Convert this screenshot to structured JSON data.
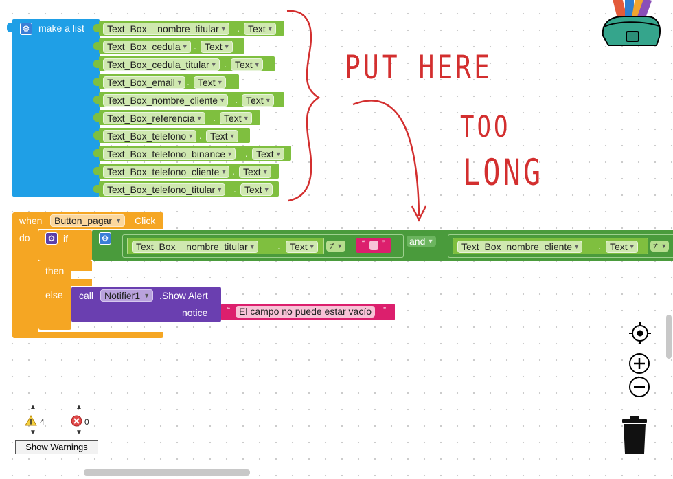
{
  "make_list": {
    "label": "make a list",
    "items": [
      {
        "component": "Text_Box__nombre_titular",
        "property": "Text"
      },
      {
        "component": "Text_Box_cedula",
        "property": "Text"
      },
      {
        "component": "Text_Box_cedula_titular",
        "property": "Text"
      },
      {
        "component": "Text_Box_email",
        "property": "Text"
      },
      {
        "component": "Text_Box_nombre_cliente",
        "property": "Text"
      },
      {
        "component": "Text_Box_referencia",
        "property": "Text"
      },
      {
        "component": "Text_Box_telefono",
        "property": "Text"
      },
      {
        "component": "Text_Box_telefono_binance",
        "property": "Text"
      },
      {
        "component": "Text_Box_telefono_cliente",
        "property": "Text"
      },
      {
        "component": "Text_Box_telefono_titular",
        "property": "Text"
      }
    ]
  },
  "event": {
    "when": "when",
    "component": "Button_pagar",
    "event": "Click",
    "do": "do",
    "if": "if",
    "then": "then",
    "else": "else"
  },
  "condition": {
    "left_component": "Text_Box__nombre_titular",
    "left_property": "Text",
    "op1": "≠",
    "quote_open": "“",
    "quote_close": "”",
    "and": "and",
    "right_component": "Text_Box_nombre_cliente",
    "right_property": "Text",
    "op2": "≠"
  },
  "call": {
    "call": "call",
    "component": "Notifier1",
    "method": ".Show Alert",
    "notice": "notice",
    "message": "El campo no puede estar vacío"
  },
  "annotation": {
    "line1": "PUT HERE",
    "line2": "TOO",
    "line3": "LONG"
  },
  "warnings": {
    "warning_count": "4",
    "error_count": "0",
    "show_button": "Show Warnings"
  },
  "icons": {
    "backpack": "backpack-icon",
    "target": "center-target-icon",
    "zoom_in": "zoom-in-icon",
    "zoom_out": "zoom-out-icon",
    "trash": "trash-icon"
  },
  "colors": {
    "list_blue": "#1f9fe6",
    "text_green": "#7fbf3f",
    "logic_green": "#4a9b3c",
    "control_orange": "#f5a623",
    "call_purple": "#6a3fb0",
    "string_pink": "#dc1f6d",
    "annotation_red": "#d32f2f"
  }
}
